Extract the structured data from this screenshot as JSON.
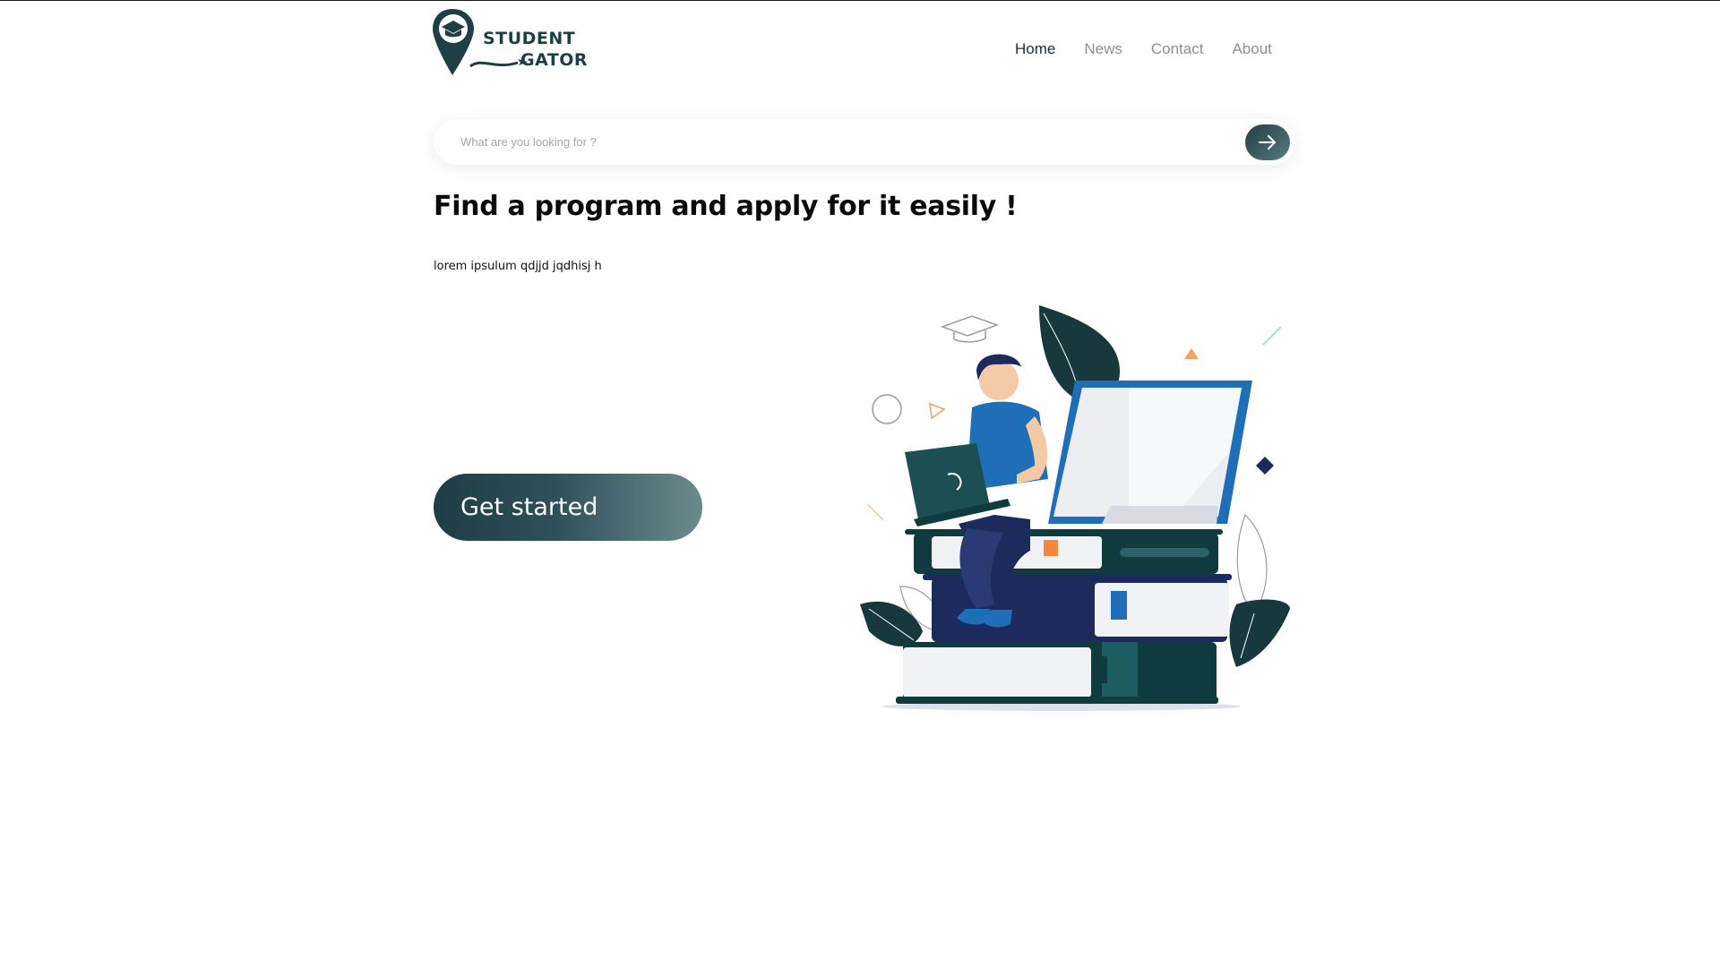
{
  "brand": {
    "line1": "STUDENT",
    "line2": "GATOR"
  },
  "nav": {
    "items": [
      {
        "label": "Home",
        "active": true
      },
      {
        "label": "News",
        "active": false
      },
      {
        "label": "Contact",
        "active": false
      },
      {
        "label": "About",
        "active": false
      }
    ]
  },
  "search": {
    "placeholder": "What are you looking for ?",
    "button_icon": "arrow-right-icon"
  },
  "hero": {
    "headline": "Find a program and apply for it easily !",
    "subtext": "lorem ipsulum qdjjd jqdhisj h",
    "cta_label": "Get started"
  },
  "colors": {
    "primary_dark": "#1f3d44",
    "primary_light": "#6b8c8e",
    "nav_active": "#14303a",
    "nav_inactive": "#8f8f8f",
    "accent_blue": "#1f6fb8",
    "accent_orange": "#f4a261"
  }
}
